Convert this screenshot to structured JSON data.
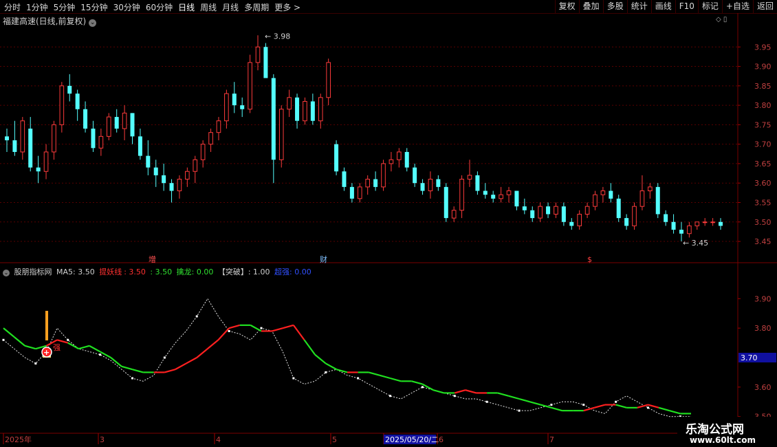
{
  "toolbar": {
    "periods": [
      "分时",
      "1分钟",
      "5分钟",
      "15分钟",
      "30分钟",
      "60分钟",
      "日线",
      "周线",
      "月线",
      "多周期",
      "更多 >"
    ],
    "active_period": "日线",
    "buttons": [
      "复权",
      "叠加",
      "多股",
      "统计",
      "画线",
      "F10",
      "标记",
      "+自选",
      "返回"
    ]
  },
  "main_title": "福建高速(日线,前复权)",
  "price_axis": [
    "3.95",
    "3.90",
    "3.85",
    "3.80",
    "3.75",
    "3.70",
    "3.65",
    "3.60",
    "3.55",
    "3.50",
    "3.45"
  ],
  "annotations": {
    "high": "3.98",
    "low": "3.45"
  },
  "markers": [
    "增",
    "财",
    "$"
  ],
  "indicator": {
    "name": "股朋指标网",
    "ma5": "MA5: 3.50",
    "tyx_label": "提妖线",
    "tyx_val": ": 3.50",
    "tyx_val2": ": 3.50",
    "qinlong": "擒龙: 0.00",
    "tupo": "【突破】: 1.00",
    "qiang": "超强: 0.00",
    "axis": [
      "3.90",
      "3.80",
      "3.70",
      "3.60",
      "3.50"
    ],
    "current": "3.70",
    "signal": "强"
  },
  "date_axis": [
    "2025年",
    "3",
    "4",
    "5",
    "2025/05/20/二",
    "6",
    "7"
  ],
  "logo": {
    "line1": "乐淘公式网",
    "line2": "www.60lt.com"
  },
  "chart_data": {
    "type": "candlestick",
    "title": "福建高速(日线,前复权)",
    "ylim": [
      3.42,
      4.0
    ],
    "ohlc": [
      [
        3.72,
        3.74,
        3.68,
        3.71
      ],
      [
        3.71,
        3.76,
        3.67,
        3.68
      ],
      [
        3.68,
        3.77,
        3.66,
        3.76
      ],
      [
        3.74,
        3.77,
        3.63,
        3.64
      ],
      [
        3.64,
        3.67,
        3.6,
        3.63
      ],
      [
        3.63,
        3.7,
        3.61,
        3.68
      ],
      [
        3.68,
        3.76,
        3.66,
        3.75
      ],
      [
        3.75,
        3.86,
        3.73,
        3.85
      ],
      [
        3.85,
        3.88,
        3.81,
        3.83
      ],
      [
        3.83,
        3.84,
        3.76,
        3.79
      ],
      [
        3.79,
        3.81,
        3.73,
        3.74
      ],
      [
        3.74,
        3.76,
        3.68,
        3.69
      ],
      [
        3.69,
        3.74,
        3.67,
        3.72
      ],
      [
        3.72,
        3.78,
        3.71,
        3.77
      ],
      [
        3.77,
        3.79,
        3.73,
        3.74
      ],
      [
        3.74,
        3.8,
        3.71,
        3.78
      ],
      [
        3.78,
        3.78,
        3.7,
        3.72
      ],
      [
        3.72,
        3.74,
        3.66,
        3.67
      ],
      [
        3.67,
        3.71,
        3.62,
        3.64
      ],
      [
        3.64,
        3.66,
        3.59,
        3.62
      ],
      [
        3.62,
        3.65,
        3.58,
        3.6
      ],
      [
        3.6,
        3.61,
        3.55,
        3.58
      ],
      [
        3.58,
        3.62,
        3.56,
        3.61
      ],
      [
        3.61,
        3.64,
        3.59,
        3.63
      ],
      [
        3.63,
        3.67,
        3.6,
        3.66
      ],
      [
        3.66,
        3.71,
        3.64,
        3.7
      ],
      [
        3.7,
        3.74,
        3.68,
        3.73
      ],
      [
        3.73,
        3.77,
        3.71,
        3.76
      ],
      [
        3.76,
        3.84,
        3.74,
        3.83
      ],
      [
        3.83,
        3.86,
        3.78,
        3.8
      ],
      [
        3.8,
        3.82,
        3.77,
        3.79
      ],
      [
        3.79,
        3.93,
        3.78,
        3.91
      ],
      [
        3.91,
        3.98,
        3.89,
        3.95
      ],
      [
        3.95,
        3.96,
        3.88,
        3.87
      ],
      [
        3.87,
        3.88,
        3.6,
        3.66
      ],
      [
        3.66,
        3.8,
        3.64,
        3.79
      ],
      [
        3.79,
        3.84,
        3.77,
        3.82
      ],
      [
        3.82,
        3.83,
        3.74,
        3.76
      ],
      [
        3.76,
        3.82,
        3.75,
        3.81
      ],
      [
        3.81,
        3.83,
        3.75,
        3.76
      ],
      [
        3.76,
        3.83,
        3.74,
        3.82
      ],
      [
        3.82,
        3.92,
        3.8,
        3.91
      ],
      [
        3.7,
        3.71,
        3.62,
        3.63
      ],
      [
        3.63,
        3.64,
        3.58,
        3.59
      ],
      [
        3.59,
        3.6,
        3.55,
        3.56
      ],
      [
        3.56,
        3.6,
        3.55,
        3.59
      ],
      [
        3.59,
        3.62,
        3.57,
        3.61
      ],
      [
        3.61,
        3.63,
        3.58,
        3.59
      ],
      [
        3.59,
        3.66,
        3.58,
        3.65
      ],
      [
        3.65,
        3.68,
        3.63,
        3.66
      ],
      [
        3.66,
        3.69,
        3.64,
        3.68
      ],
      [
        3.68,
        3.69,
        3.63,
        3.64
      ],
      [
        3.64,
        3.65,
        3.59,
        3.6
      ],
      [
        3.6,
        3.61,
        3.57,
        3.58
      ],
      [
        3.58,
        3.63,
        3.56,
        3.61
      ],
      [
        3.61,
        3.62,
        3.58,
        3.59
      ],
      [
        3.59,
        3.6,
        3.5,
        3.51
      ],
      [
        3.51,
        3.54,
        3.5,
        3.53
      ],
      [
        3.53,
        3.62,
        3.51,
        3.61
      ],
      [
        3.61,
        3.66,
        3.59,
        3.62
      ],
      [
        3.62,
        3.63,
        3.57,
        3.58
      ],
      [
        3.58,
        3.6,
        3.56,
        3.57
      ],
      [
        3.57,
        3.58,
        3.55,
        3.56
      ],
      [
        3.56,
        3.59,
        3.55,
        3.57
      ],
      [
        3.57,
        3.59,
        3.55,
        3.58
      ],
      [
        3.58,
        3.58,
        3.53,
        3.54
      ],
      [
        3.54,
        3.56,
        3.52,
        3.53
      ],
      [
        3.53,
        3.54,
        3.5,
        3.51
      ],
      [
        3.51,
        3.55,
        3.5,
        3.54
      ],
      [
        3.54,
        3.55,
        3.51,
        3.52
      ],
      [
        3.52,
        3.55,
        3.51,
        3.54
      ],
      [
        3.54,
        3.55,
        3.49,
        3.5
      ],
      [
        3.5,
        3.51,
        3.48,
        3.49
      ],
      [
        3.49,
        3.53,
        3.48,
        3.52
      ],
      [
        3.52,
        3.55,
        3.51,
        3.54
      ],
      [
        3.54,
        3.58,
        3.53,
        3.57
      ],
      [
        3.57,
        3.59,
        3.55,
        3.58
      ],
      [
        3.58,
        3.6,
        3.55,
        3.56
      ],
      [
        3.56,
        3.57,
        3.5,
        3.51
      ],
      [
        3.51,
        3.52,
        3.48,
        3.49
      ],
      [
        3.49,
        3.55,
        3.48,
        3.54
      ],
      [
        3.54,
        3.62,
        3.53,
        3.58
      ],
      [
        3.58,
        3.6,
        3.56,
        3.59
      ],
      [
        3.59,
        3.6,
        3.51,
        3.52
      ],
      [
        3.52,
        3.53,
        3.49,
        3.5
      ],
      [
        3.5,
        3.52,
        3.47,
        3.48
      ],
      [
        3.48,
        3.5,
        3.45,
        3.47
      ],
      [
        3.47,
        3.5,
        3.46,
        3.49
      ],
      [
        3.49,
        3.5,
        3.48,
        3.5
      ],
      [
        3.5,
        3.51,
        3.49,
        3.5
      ],
      [
        3.5,
        3.51,
        3.49,
        3.5
      ],
      [
        3.5,
        3.51,
        3.48,
        3.49
      ]
    ],
    "ma_line": [
      3.8,
      3.77,
      3.74,
      3.73,
      3.74,
      3.76,
      3.75,
      3.73,
      3.74,
      3.72,
      3.7,
      3.67,
      3.66,
      3.65,
      3.65,
      3.65,
      3.66,
      3.68,
      3.7,
      3.73,
      3.76,
      3.8,
      3.81,
      3.81,
      3.79,
      3.79,
      3.8,
      3.81,
      3.76,
      3.71,
      3.68,
      3.66,
      3.65,
      3.65,
      3.65,
      3.64,
      3.63,
      3.62,
      3.62,
      3.61,
      3.59,
      3.58,
      3.58,
      3.59,
      3.58,
      3.58,
      3.58,
      3.57,
      3.56,
      3.55,
      3.54,
      3.53,
      3.52,
      3.52,
      3.52,
      3.53,
      3.54,
      3.54,
      3.53,
      3.53,
      3.54,
      3.53,
      3.52,
      3.51,
      3.51
    ],
    "ma_trend": [
      "g",
      "g",
      "g",
      "g",
      "r",
      "r",
      "g",
      "g",
      "g",
      "g",
      "g",
      "g",
      "g",
      "g",
      "r",
      "r",
      "r",
      "r",
      "r",
      "r",
      "r",
      "r",
      "g",
      "g",
      "r",
      "r",
      "r",
      "r",
      "g",
      "g",
      "g",
      "g",
      "r",
      "g",
      "g",
      "g",
      "g",
      "g",
      "g",
      "g",
      "g",
      "g",
      "r",
      "r",
      "r",
      "g",
      "g",
      "g",
      "g",
      "g",
      "g",
      "g",
      "g",
      "g",
      "r",
      "r",
      "r",
      "g",
      "g",
      "r",
      "r",
      "g",
      "g",
      "g",
      "g"
    ],
    "price_line": [
      3.76,
      3.73,
      3.7,
      3.68,
      3.72,
      3.8,
      3.76,
      3.73,
      3.72,
      3.71,
      3.69,
      3.66,
      3.63,
      3.62,
      3.64,
      3.7,
      3.75,
      3.79,
      3.84,
      3.9,
      3.84,
      3.79,
      3.78,
      3.76,
      3.8,
      3.79,
      3.72,
      3.63,
      3.61,
      3.62,
      3.65,
      3.66,
      3.64,
      3.63,
      3.61,
      3.59,
      3.57,
      3.56,
      3.58,
      3.6,
      3.59,
      3.58,
      3.57,
      3.56,
      3.56,
      3.55,
      3.54,
      3.53,
      3.52,
      3.52,
      3.53,
      3.54,
      3.55,
      3.55,
      3.54,
      3.52,
      3.51,
      3.55,
      3.57,
      3.55,
      3.53,
      3.51,
      3.5,
      3.5,
      3.5
    ],
    "ind_ylim": [
      3.49,
      3.98
    ]
  }
}
